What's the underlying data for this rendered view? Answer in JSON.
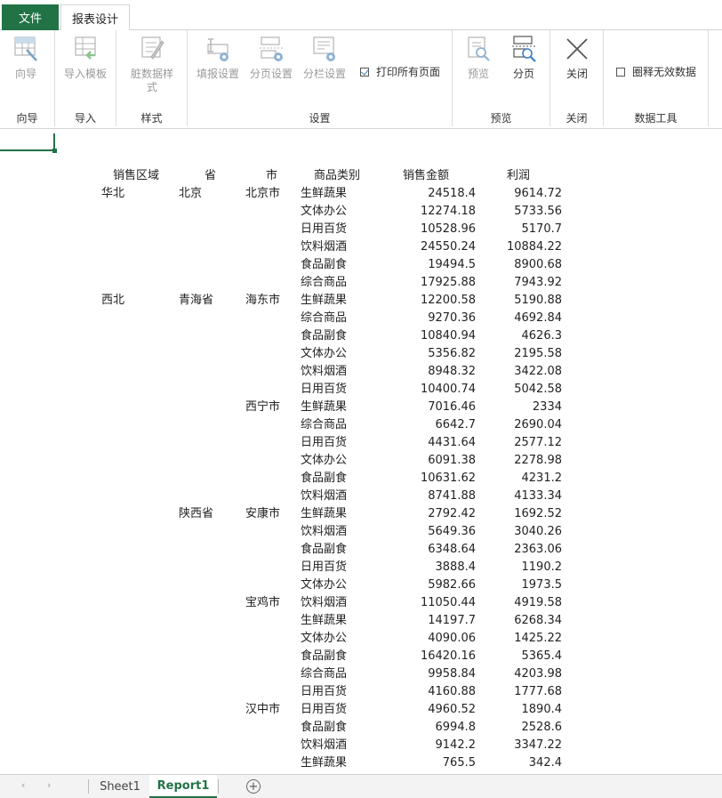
{
  "tabs": {
    "file": "文件",
    "report_design": "报表设计"
  },
  "ribbon": {
    "groups": {
      "wizard": "向导",
      "import": "导入",
      "style": "样式",
      "settings": "设置",
      "preview": "预览",
      "close": "关闭",
      "data_tools": "数据工具"
    },
    "buttons": {
      "wizard": "向导",
      "import_template": "导入模板",
      "dirty_style": "脏数据样式",
      "fill_settings": "填报设置",
      "page_settings": "分页设置",
      "column_settings": "分栏设置",
      "preview": "预览",
      "paging": "分页",
      "close": "关闭"
    },
    "checkboxes": {
      "print_all_pages": "打印所有页面",
      "circle_invalid": "圈释无效数据"
    }
  },
  "report": {
    "headers": {
      "region": "销售区域",
      "province": "省",
      "city": "市",
      "category": "商品类别",
      "amount": "销售金额",
      "profit": "利润"
    },
    "rows": [
      {
        "region": "华北",
        "province": "北京",
        "city": "北京市",
        "category": "生鲜蔬果",
        "amount": "24518.4",
        "profit": "9614.72"
      },
      {
        "region": "",
        "province": "",
        "city": "",
        "category": "文体办公",
        "amount": "12274.18",
        "profit": "5733.56"
      },
      {
        "region": "",
        "province": "",
        "city": "",
        "category": "日用百货",
        "amount": "10528.96",
        "profit": "5170.7"
      },
      {
        "region": "",
        "province": "",
        "city": "",
        "category": "饮料烟酒",
        "amount": "24550.24",
        "profit": "10884.22"
      },
      {
        "region": "",
        "province": "",
        "city": "",
        "category": "食品副食",
        "amount": "19494.5",
        "profit": "8900.68"
      },
      {
        "region": "",
        "province": "",
        "city": "",
        "category": "综合商品",
        "amount": "17925.88",
        "profit": "7943.92"
      },
      {
        "region": "西北",
        "province": "青海省",
        "city": "海东市",
        "category": "生鲜蔬果",
        "amount": "12200.58",
        "profit": "5190.88"
      },
      {
        "region": "",
        "province": "",
        "city": "",
        "category": "综合商品",
        "amount": "9270.36",
        "profit": "4692.84"
      },
      {
        "region": "",
        "province": "",
        "city": "",
        "category": "食品副食",
        "amount": "10840.94",
        "profit": "4626.3"
      },
      {
        "region": "",
        "province": "",
        "city": "",
        "category": "文体办公",
        "amount": "5356.82",
        "profit": "2195.58"
      },
      {
        "region": "",
        "province": "",
        "city": "",
        "category": "饮料烟酒",
        "amount": "8948.32",
        "profit": "3422.08"
      },
      {
        "region": "",
        "province": "",
        "city": "",
        "category": "日用百货",
        "amount": "10400.74",
        "profit": "5042.58"
      },
      {
        "region": "",
        "province": "",
        "city": "西宁市",
        "category": "生鲜蔬果",
        "amount": "7016.46",
        "profit": "2334"
      },
      {
        "region": "",
        "province": "",
        "city": "",
        "category": "综合商品",
        "amount": "6642.7",
        "profit": "2690.04"
      },
      {
        "region": "",
        "province": "",
        "city": "",
        "category": "日用百货",
        "amount": "4431.64",
        "profit": "2577.12"
      },
      {
        "region": "",
        "province": "",
        "city": "",
        "category": "文体办公",
        "amount": "6091.38",
        "profit": "2278.98"
      },
      {
        "region": "",
        "province": "",
        "city": "",
        "category": "食品副食",
        "amount": "10631.62",
        "profit": "4231.2"
      },
      {
        "region": "",
        "province": "",
        "city": "",
        "category": "饮料烟酒",
        "amount": "8741.88",
        "profit": "4133.34"
      },
      {
        "region": "",
        "province": "陕西省",
        "city": "安康市",
        "category": "生鲜蔬果",
        "amount": "2792.42",
        "profit": "1692.52"
      },
      {
        "region": "",
        "province": "",
        "city": "",
        "category": "饮料烟酒",
        "amount": "5649.36",
        "profit": "3040.26"
      },
      {
        "region": "",
        "province": "",
        "city": "",
        "category": "食品副食",
        "amount": "6348.64",
        "profit": "2363.06"
      },
      {
        "region": "",
        "province": "",
        "city": "",
        "category": "日用百货",
        "amount": "3888.4",
        "profit": "1190.2"
      },
      {
        "region": "",
        "province": "",
        "city": "",
        "category": "文体办公",
        "amount": "5982.66",
        "profit": "1973.5"
      },
      {
        "region": "",
        "province": "",
        "city": "宝鸡市",
        "category": "饮料烟酒",
        "amount": "11050.44",
        "profit": "4919.58"
      },
      {
        "region": "",
        "province": "",
        "city": "",
        "category": "生鲜蔬果",
        "amount": "14197.7",
        "profit": "6268.34"
      },
      {
        "region": "",
        "province": "",
        "city": "",
        "category": "文体办公",
        "amount": "4090.06",
        "profit": "1425.22"
      },
      {
        "region": "",
        "province": "",
        "city": "",
        "category": "食品副食",
        "amount": "16420.16",
        "profit": "5365.4"
      },
      {
        "region": "",
        "province": "",
        "city": "",
        "category": "综合商品",
        "amount": "9958.84",
        "profit": "4203.98"
      },
      {
        "region": "",
        "province": "",
        "city": "",
        "category": "日用百货",
        "amount": "4160.88",
        "profit": "1777.68"
      },
      {
        "region": "",
        "province": "",
        "city": "汉中市",
        "category": "日用百货",
        "amount": "4960.52",
        "profit": "1890.4"
      },
      {
        "region": "",
        "province": "",
        "city": "",
        "category": "食品副食",
        "amount": "6994.8",
        "profit": "2528.6"
      },
      {
        "region": "",
        "province": "",
        "city": "",
        "category": "饮料烟酒",
        "amount": "9142.2",
        "profit": "3347.22"
      },
      {
        "region": "",
        "province": "",
        "city": "",
        "category": "生鲜蔬果",
        "amount": "765.5",
        "profit": "342.4"
      }
    ]
  },
  "sheet_tabs": {
    "sheet1": "Sheet1",
    "report1": "Report1",
    "add": "+"
  },
  "colors": {
    "accent": "#217346"
  }
}
